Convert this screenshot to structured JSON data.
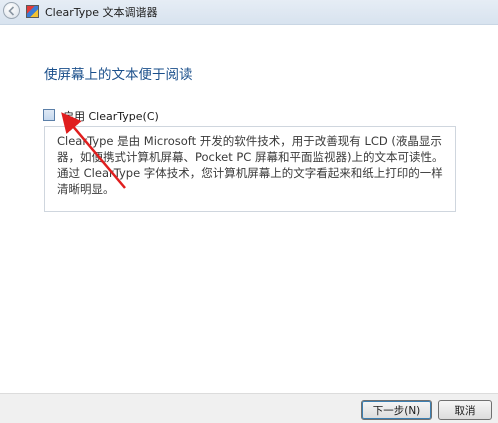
{
  "window": {
    "title": "ClearType 文本调谐器",
    "back_icon": "back-arrow-icon",
    "app_icon": "cleartype-app-icon"
  },
  "main": {
    "heading": "使屏幕上的文本便于阅读",
    "checkbox_label": "启用 ClearType(C)",
    "checkbox_checked": false,
    "description": "ClearType 是由 Microsoft 开发的软件技术，用于改善现有 LCD (液晶显示器，如便携式计算机屏幕、Pocket PC 屏幕和平面监视器)上的文本可读性。通过 ClearType 字体技术，您计算机屏幕上的文字看起来和纸上打印的一样清晰明显。"
  },
  "footer": {
    "next_label": "下一步(N)",
    "cancel_label": "取消"
  },
  "colors": {
    "heading": "#1a4f8b",
    "annotation_arrow": "#e01e1e"
  }
}
